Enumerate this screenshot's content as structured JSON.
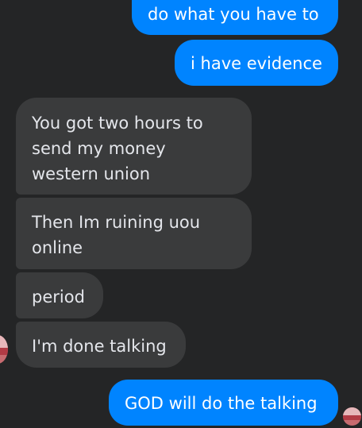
{
  "conversation": {
    "messages": [
      {
        "from": "me",
        "text": "do what you have to"
      },
      {
        "from": "me",
        "text": "i have evidence"
      },
      {
        "from": "them",
        "text": "You got two hours to\nsend my money\nwestern union"
      },
      {
        "from": "them",
        "text": "Then Im ruining uou\nonline"
      },
      {
        "from": "them",
        "text": "period"
      },
      {
        "from": "them",
        "text": "I'm done talking"
      },
      {
        "from": "me",
        "text": "GOD will do the talking"
      }
    ]
  },
  "colors": {
    "background": "#242526",
    "sent_bubble": "#0084ff",
    "received_bubble": "#3a3b3c",
    "sent_text": "#ffffff",
    "received_text": "#e4e6eb"
  },
  "icons": {
    "sender_avatar": "contact-avatar-icon",
    "read_receipt": "read-receipt-avatar-icon"
  }
}
